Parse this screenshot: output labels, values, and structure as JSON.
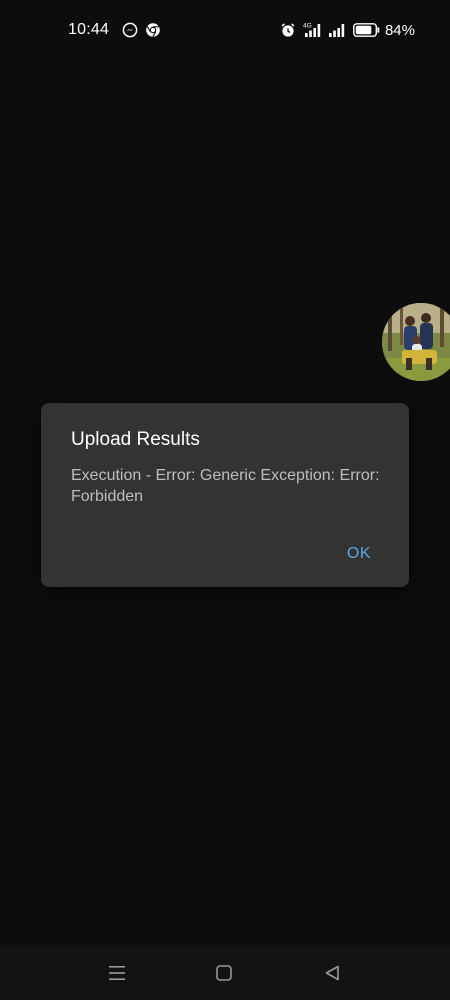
{
  "status_bar": {
    "time": "10:44",
    "left_icons": [
      "messenger-icon",
      "chrome-icon"
    ],
    "right_icons": [
      "alarm-icon",
      "signal-4g-icon",
      "signal-icon",
      "battery-icon"
    ],
    "network_label": "4G",
    "battery_percent": "84%",
    "battery_level": 0.84
  },
  "chat_head": {
    "icon": "profile-photo"
  },
  "dialog": {
    "title": "Upload Results",
    "message": "Execution - Error: Generic Exception: Error: Forbidden",
    "ok_label": "OK"
  },
  "nav_bar": {
    "buttons": [
      "menu-icon",
      "home-icon",
      "back-icon"
    ]
  },
  "colors": {
    "background": "#0d0d0d",
    "dialog_bg": "#333333",
    "accent": "#5aa9e6",
    "message_text": "#bdbdbd"
  }
}
